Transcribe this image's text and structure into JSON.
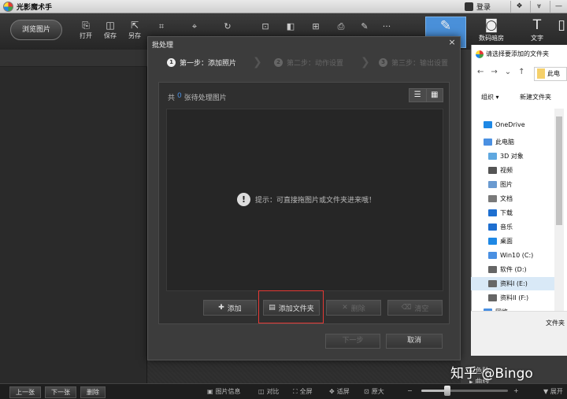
{
  "app": {
    "title": "光影魔术手"
  },
  "titlebar": {
    "login": "登录",
    "ctrl_skin": "❖",
    "ctrl_menu": "⩔",
    "ctrl_min": "—"
  },
  "toolbar": {
    "browse": "浏览图片",
    "tools": [
      {
        "label": "打开",
        "icon": "⎘"
      },
      {
        "label": "保存",
        "icon": "◫"
      },
      {
        "label": "另存",
        "icon": "⇱"
      }
    ],
    "small_tools": [
      "⌗",
      "⌖",
      "↻",
      "⊡",
      "◧",
      "⊞",
      "⎙",
      "✎",
      "···"
    ],
    "right_tools": [
      {
        "label": "",
        "icon": "✎"
      },
      {
        "label": "数码暗房",
        "icon": "◙"
      },
      {
        "label": "文字",
        "icon": "T"
      },
      {
        "label": "",
        "icon": "▯"
      }
    ]
  },
  "batch": {
    "title": "批处理",
    "close": "×",
    "steps": [
      {
        "num": "1",
        "label": "第一步：添加照片"
      },
      {
        "num": "2",
        "label": "第二步：动作设置"
      },
      {
        "num": "3",
        "label": "第三步：输出设置"
      }
    ],
    "count_prefix": "共",
    "count_num": "0",
    "count_suffix": "张待处理图片",
    "view_list": "☰",
    "view_grid": "▦",
    "hint_icon": "!",
    "hint": "提示：可直接拖图片或文件夹进来哦！",
    "buttons": {
      "add": "添加",
      "add_icon": "✚",
      "add_folder": "添加文件夹",
      "add_folder_icon": "▤",
      "delete": "删除",
      "delete_icon": "✕",
      "clear": "清空",
      "clear_icon": "⌫"
    },
    "next": "下一步",
    "cancel": "取消"
  },
  "file_dialog": {
    "title": "请选择要添加的文件夹",
    "nav_back": "←",
    "nav_forward": "→",
    "nav_down": "⌄",
    "nav_up": "↑",
    "path_text": "此电",
    "organize": "组织 ▾",
    "new_folder": "新建文件夹",
    "tree": [
      {
        "label": "OneDrive",
        "indent": 0,
        "color": "#1e88e5"
      },
      {
        "label": "此电脑",
        "indent": 0,
        "color": "#4a90e2"
      },
      {
        "label": "3D 对象",
        "indent": 1,
        "color": "#5fa8e0"
      },
      {
        "label": "视频",
        "indent": 1,
        "color": "#555"
      },
      {
        "label": "图片",
        "indent": 1,
        "color": "#6a9ad0"
      },
      {
        "label": "文档",
        "indent": 1,
        "color": "#7a7a7a"
      },
      {
        "label": "下载",
        "indent": 1,
        "color": "#1e6fd0"
      },
      {
        "label": "音乐",
        "indent": 1,
        "color": "#1e6fd0"
      },
      {
        "label": "桌面",
        "indent": 1,
        "color": "#1e88e5"
      },
      {
        "label": "Win10 (C:)",
        "indent": 1,
        "color": "#4a90e2"
      },
      {
        "label": "软件 (D:)",
        "indent": 1,
        "color": "#666"
      },
      {
        "label": "资料I (E:)",
        "indent": 1,
        "color": "#666"
      },
      {
        "label": "资料II (F:)",
        "indent": 1,
        "color": "#666"
      },
      {
        "label": "网络",
        "indent": 0,
        "color": "#4a90e2"
      }
    ],
    "folder_label": "文件夹"
  },
  "right_panel": {
    "item1": "▸ 色阶",
    "item2": "▸ 曲线"
  },
  "statusbar": {
    "prev": "上一张",
    "next": "下一张",
    "delete": "删除",
    "items": [
      {
        "icon": "▣",
        "label": "图片信息"
      },
      {
        "icon": "◫",
        "label": "对比"
      },
      {
        "icon": "⛶",
        "label": "全屏"
      },
      {
        "icon": "✥",
        "label": "适屏"
      },
      {
        "icon": "⊡",
        "label": "原大"
      }
    ],
    "zoom_minus": "−",
    "zoom_plus": "+",
    "zoom_level": 0.3,
    "expand": "▼ 展开"
  },
  "watermark": "知乎 @Bingo"
}
